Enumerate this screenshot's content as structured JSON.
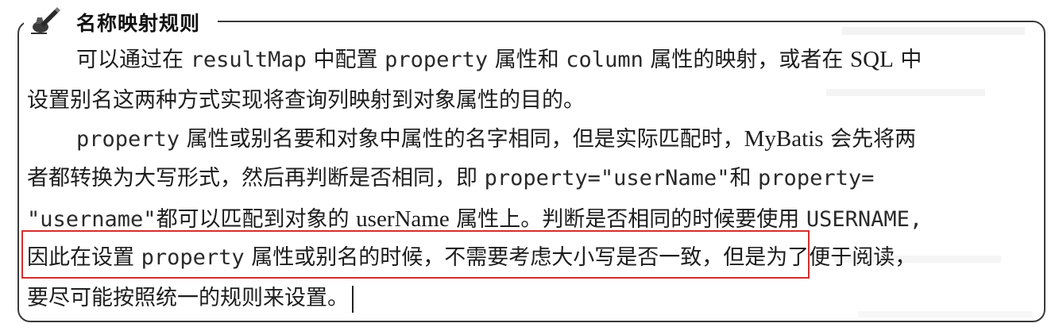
{
  "tip": {
    "title": "名称映射规则",
    "icon": "pen-writing-icon"
  },
  "paragraphs": [
    {
      "lines": [
        {
          "segments": [
            {
              "text": "可以通过在 ",
              "style": "cjk"
            },
            {
              "text": "resultMap",
              "style": "mono"
            },
            {
              "text": " 中配置 ",
              "style": "cjk"
            },
            {
              "text": "property",
              "style": "mono"
            },
            {
              "text": " 属性和 ",
              "style": "cjk"
            },
            {
              "text": "column",
              "style": "mono"
            },
            {
              "text": " 属性的映射，或者在 ",
              "style": "cjk"
            },
            {
              "text": "SQL",
              "style": "latin"
            },
            {
              "text": " 中",
              "style": "cjk"
            }
          ]
        },
        {
          "segments": [
            {
              "text": "设置别名这两种方式实现将查询列映射到对象属性的目的。",
              "style": "cjk"
            }
          ]
        }
      ]
    },
    {
      "lines": [
        {
          "segments": [
            {
              "text": "property",
              "style": "mono"
            },
            {
              "text": " 属性或别名要和对象中属性的名字相同，但是实际匹配时，",
              "style": "cjk"
            },
            {
              "text": "MyBatis",
              "style": "latin"
            },
            {
              "text": " 会先将两",
              "style": "cjk"
            }
          ]
        },
        {
          "segments": [
            {
              "text": "者都转换为大写形式，然后再判断是否相同，即 ",
              "style": "cjk"
            },
            {
              "text": "property=\"userName\"",
              "style": "mono"
            },
            {
              "text": "和 ",
              "style": "cjk"
            },
            {
              "text": "property=",
              "style": "mono"
            }
          ]
        },
        {
          "segments": [
            {
              "text": "\"username\"",
              "style": "mono"
            },
            {
              "text": "都可以匹配到对象的 ",
              "style": "cjk"
            },
            {
              "text": "userName",
              "style": "latin"
            },
            {
              "text": " 属性上。判断是否相同的时候要使用 ",
              "style": "cjk"
            },
            {
              "text": "USERNAME,",
              "style": "mono"
            }
          ]
        },
        {
          "segments": [
            {
              "text": "因此在设置 ",
              "style": "cjk"
            },
            {
              "text": "property",
              "style": "mono"
            },
            {
              "text": " 属性或别名的时候，不需要考虑大小写是否一致，但是为了便于阅读，",
              "style": "cjk"
            }
          ]
        },
        {
          "segments": [
            {
              "text": "要尽可能按照统一的规则来设置。",
              "style": "cjk"
            }
          ]
        }
      ]
    }
  ],
  "highlight_color": "#d32f2f",
  "border_color": "#3a3a3a"
}
